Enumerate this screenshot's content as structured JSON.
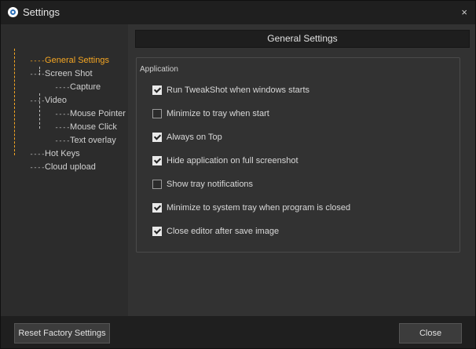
{
  "window": {
    "title": "Settings",
    "close_glyph": "×",
    "app_icon": "tweakshot-logo-icon"
  },
  "sidebar": {
    "items": [
      {
        "label": "General Settings",
        "selected": true
      },
      {
        "label": "Screen Shot",
        "selected": false
      },
      {
        "label": "Capture",
        "selected": false
      },
      {
        "label": "Video",
        "selected": false
      },
      {
        "label": "Mouse Pointer",
        "selected": false
      },
      {
        "label": "Mouse Click",
        "selected": false
      },
      {
        "label": "Text overlay",
        "selected": false
      },
      {
        "label": "Hot Keys",
        "selected": false
      },
      {
        "label": "Cloud upload",
        "selected": false
      }
    ]
  },
  "main": {
    "header_title": "General Settings",
    "group_label": "Application",
    "options": [
      {
        "label": "Run TweakShot when windows starts",
        "checked": true
      },
      {
        "label": "Minimize to tray when start",
        "checked": false
      },
      {
        "label": "Always on Top",
        "checked": true
      },
      {
        "label": "Hide application on full screenshot",
        "checked": true
      },
      {
        "label": "Show tray notifications",
        "checked": false
      },
      {
        "label": "Minimize to system tray when program is closed",
        "checked": true
      },
      {
        "label": "Close editor after save image",
        "checked": true
      }
    ]
  },
  "footer": {
    "reset_label": "Reset Factory Settings",
    "close_label": "Close"
  },
  "colors": {
    "accent": "#f5a623",
    "background": "#2f2f2f",
    "titlebar": "#1f1f1f"
  }
}
